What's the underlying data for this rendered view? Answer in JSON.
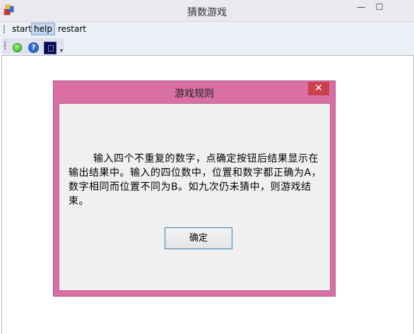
{
  "window": {
    "title": "猜数游戏",
    "min_symbol": "—",
    "max_symbol": "☐"
  },
  "menu": {
    "items": [
      "start",
      "help",
      "restart"
    ],
    "active": "help"
  },
  "toolbar": {
    "icons": [
      "start-circle-icon",
      "help-icon",
      "window-icon"
    ],
    "help_glyph": "?",
    "overflow_symbol": "▾"
  },
  "dialog": {
    "title": "游戏规则",
    "close_symbol": "✕",
    "text": "输入四个不重复的数字，点确定按钮后结果显示在输出结果中。输入的四位数中，位置和数字都正确为A，数字相同而位置不同为B。如九次仍未猜中，则游戏结束。",
    "ok_label": "确定"
  },
  "colors": {
    "dialog_frame": "#d96fa5",
    "close_button": "#c9414b",
    "menu_highlight": "#c5d7ee"
  }
}
